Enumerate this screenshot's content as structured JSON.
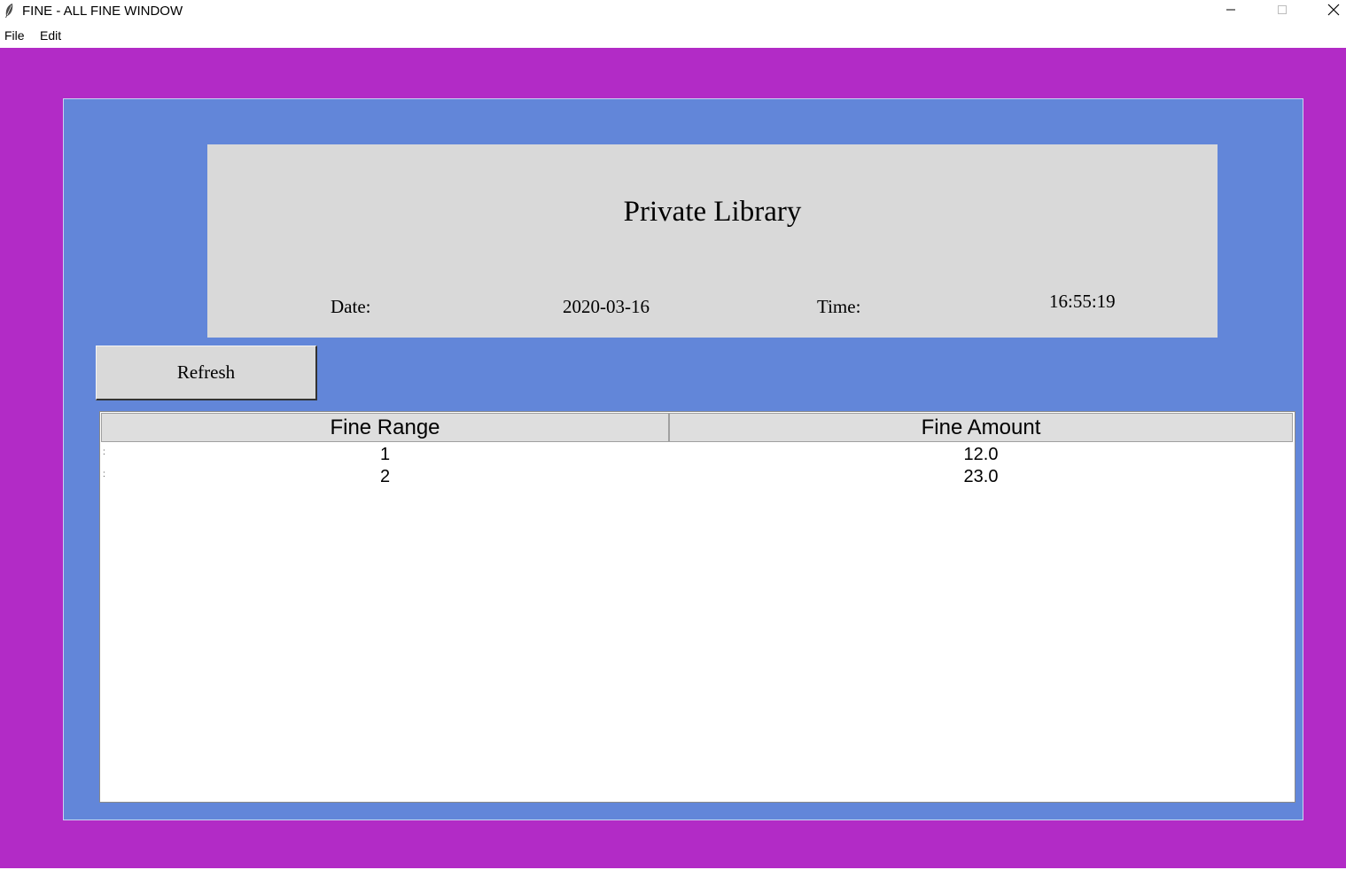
{
  "window": {
    "title": "FINE - ALL FINE WINDOW"
  },
  "menu": {
    "file": "File",
    "edit": "Edit"
  },
  "header": {
    "title": "Private Library",
    "date_label": "Date:",
    "date_value": "2020-03-16",
    "time_label": "Time:",
    "time_value": "16:55:19"
  },
  "actions": {
    "refresh_label": "Refresh"
  },
  "table": {
    "columns": [
      "Fine Range",
      "Fine Amount"
    ],
    "rows": [
      {
        "range": "1",
        "amount": "12.0"
      },
      {
        "range": "2",
        "amount": "23.0"
      }
    ]
  },
  "colors": {
    "background": "#b22bc6",
    "panel": "#6286d9",
    "header_box": "#d9d9d9"
  },
  "icons": {
    "app": "feather-icon",
    "minimize": "minimize-icon",
    "maximize": "maximize-icon",
    "close": "close-icon"
  }
}
